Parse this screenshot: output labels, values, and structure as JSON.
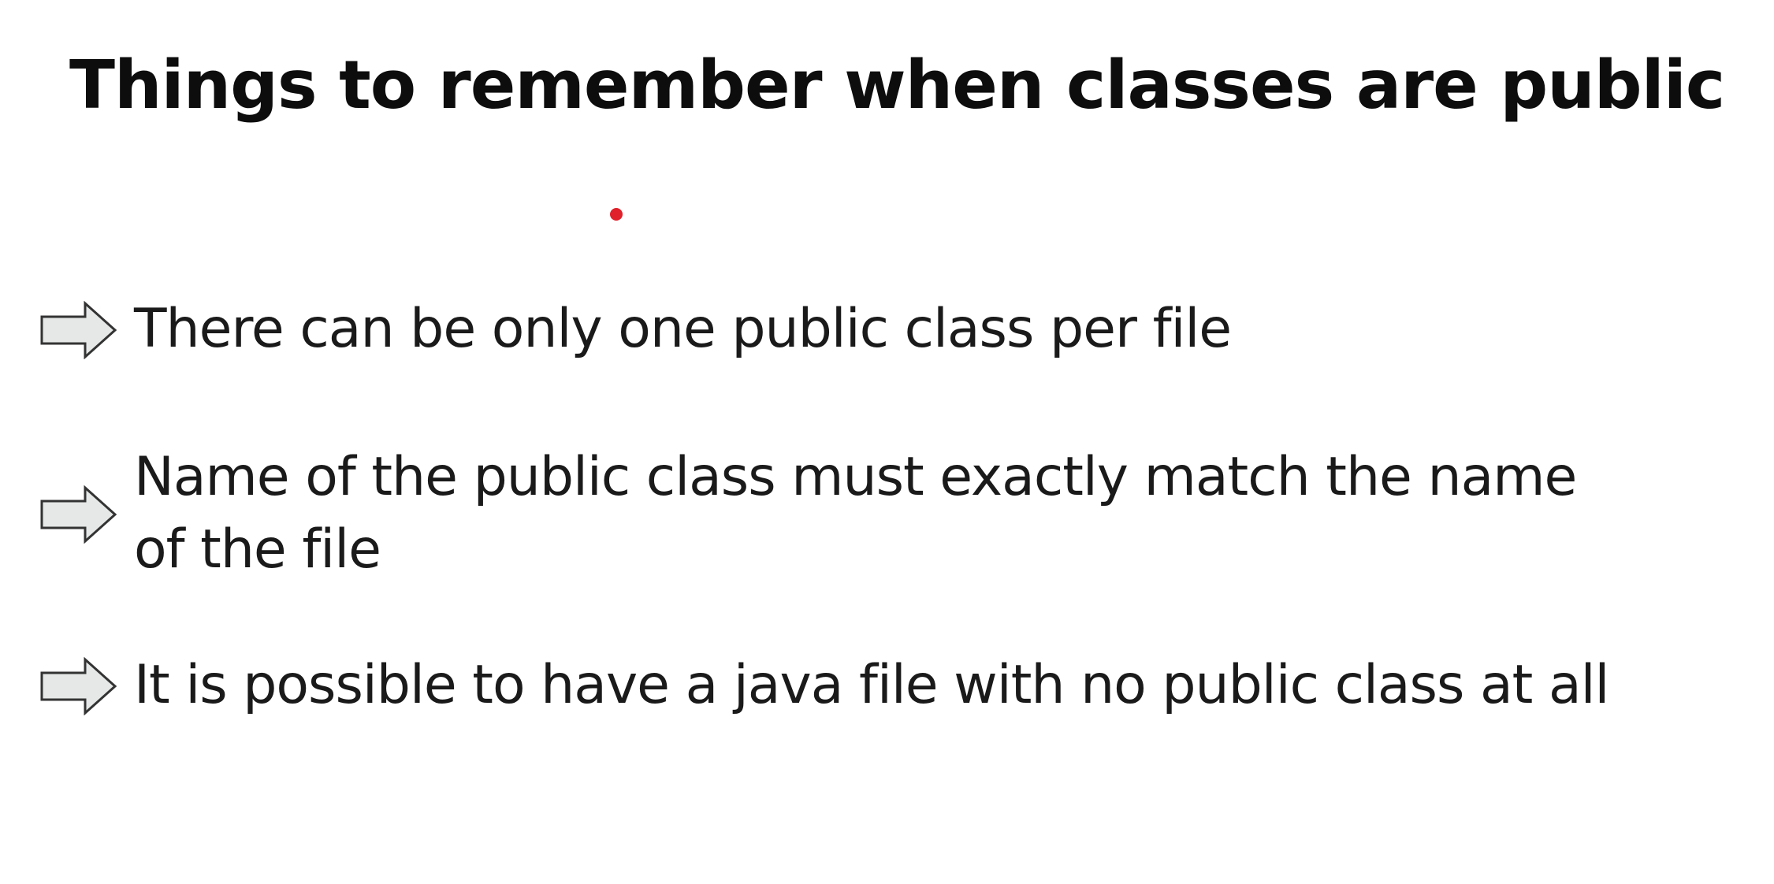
{
  "slide": {
    "title": "Things to remember when classes are public",
    "bullets": [
      {
        "icon": "right-arrow-icon",
        "lines": [
          "There can be only one public class per file"
        ]
      },
      {
        "icon": "right-arrow-icon",
        "lines": [
          "Name of the public class must exactly match the name",
          "of the file"
        ]
      },
      {
        "icon": "right-arrow-icon",
        "lines": [
          "It is possible to have a java file with no public class at all"
        ]
      }
    ]
  },
  "colors": {
    "background": "#ffffff",
    "text": "#111111",
    "pointer": "#e0202a",
    "arrow_fill": "#e6e8e8",
    "arrow_stroke": "#333333"
  }
}
